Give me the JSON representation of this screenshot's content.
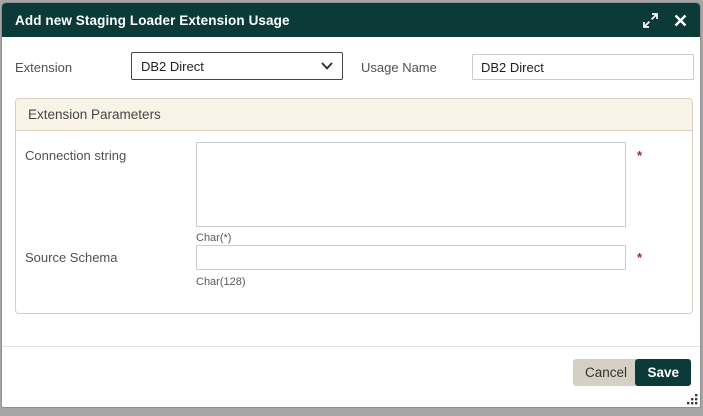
{
  "window": {
    "title": "Add new Staging Loader Extension Usage"
  },
  "form": {
    "extension": {
      "label": "Extension",
      "value": "DB2 Direct"
    },
    "usage_name": {
      "label": "Usage Name",
      "value": "DB2 Direct"
    }
  },
  "panel": {
    "title": "Extension Parameters",
    "fields": [
      {
        "label": "Connection string",
        "value": "",
        "hint": "Char(*)",
        "required_marker": "*"
      },
      {
        "label": "Source Schema",
        "value": "",
        "hint": "Char(128)",
        "required_marker": "*"
      }
    ]
  },
  "footer": {
    "cancel": "Cancel",
    "save": "Save"
  },
  "icons": {
    "expand": "expand-diagonal-icon",
    "close": "close-icon",
    "select_chevron": "chevron-down-icon",
    "resize": "resize-grip-icon"
  },
  "colors": {
    "accent_teal": "#0b3a38",
    "panel_header_bg": "#f8f2e7",
    "panel_border": "#d9d0c1",
    "required_red": "#b22222",
    "cancel_bg": "#d5d0c3",
    "page_bg": "#a6a6a6"
  }
}
